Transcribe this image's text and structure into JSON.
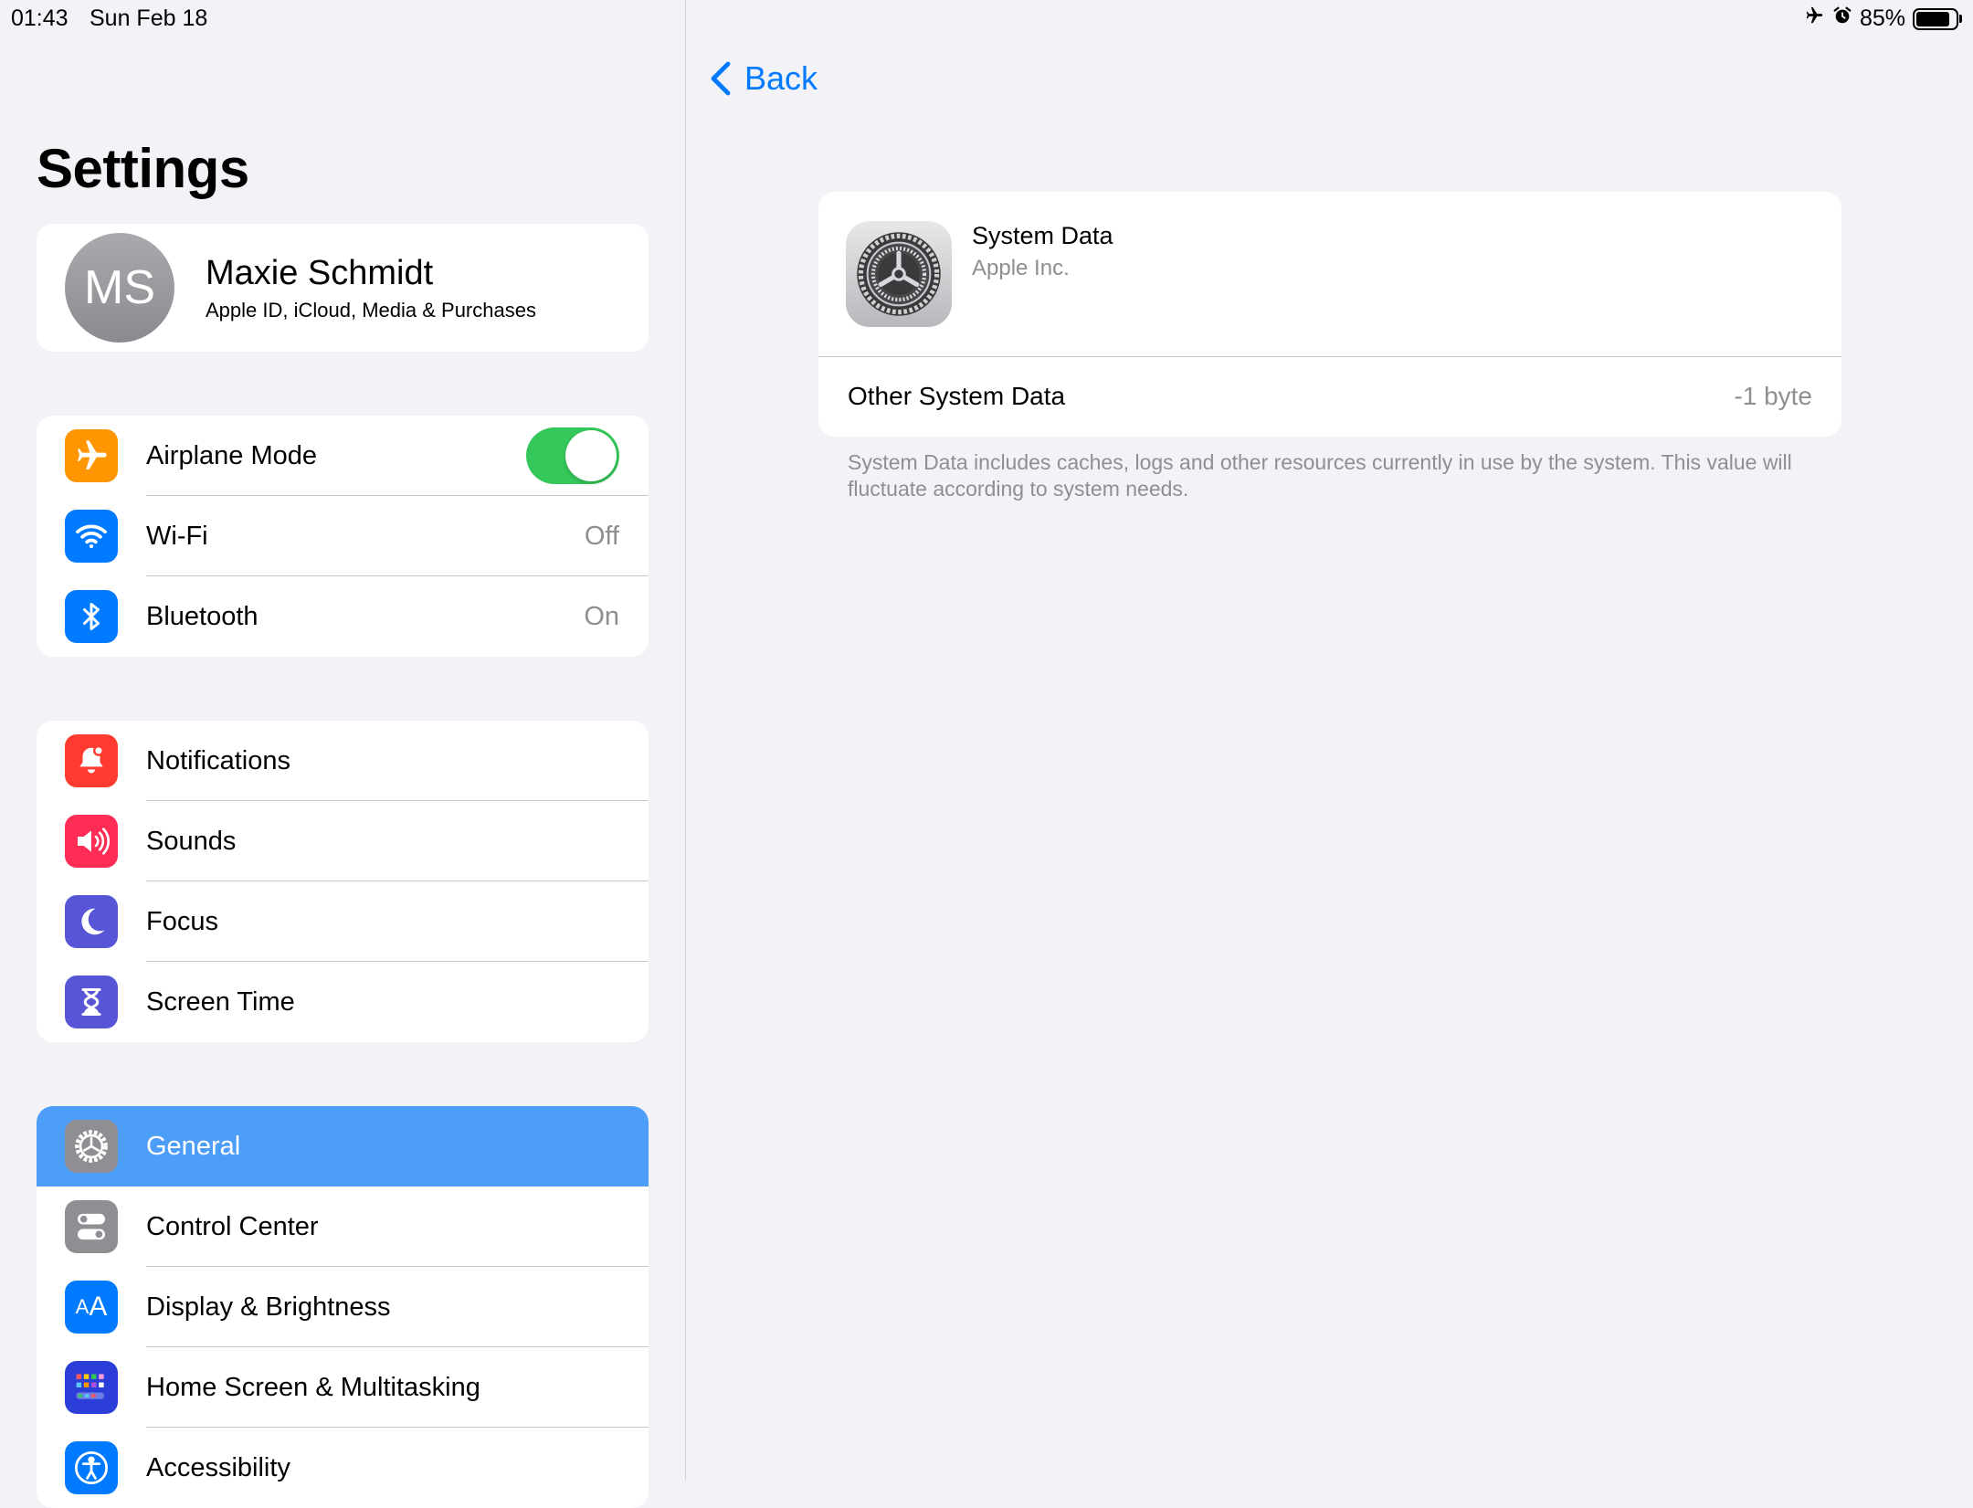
{
  "status_bar": {
    "time": "01:43",
    "date": "Sun Feb 18",
    "battery_percent": "85%",
    "battery_level": 0.85
  },
  "sidebar": {
    "title": "Settings",
    "profile": {
      "initials": "MS",
      "name": "Maxie Schmidt",
      "subtitle": "Apple ID, iCloud, Media & Purchases"
    },
    "group1": [
      {
        "label": "Airplane Mode",
        "icon": "airplane-icon",
        "color": "#ff9500",
        "toggle": true
      },
      {
        "label": "Wi-Fi",
        "icon": "wifi-icon",
        "color": "#007aff",
        "value": "Off"
      },
      {
        "label": "Bluetooth",
        "icon": "bluetooth-icon",
        "color": "#007aff",
        "value": "On"
      }
    ],
    "group2": [
      {
        "label": "Notifications",
        "icon": "bell-icon",
        "color": "#ff3b30"
      },
      {
        "label": "Sounds",
        "icon": "speaker-icon",
        "color": "#ff2d55"
      },
      {
        "label": "Focus",
        "icon": "moon-icon",
        "color": "#5856d6"
      },
      {
        "label": "Screen Time",
        "icon": "hourglass-icon",
        "color": "#5856d6"
      }
    ],
    "group3": [
      {
        "label": "General",
        "icon": "gear-icon",
        "color": "#8e8e93",
        "selected": true
      },
      {
        "label": "Control Center",
        "icon": "switches-icon",
        "color": "#8e8e93"
      },
      {
        "label": "Display & Brightness",
        "icon": "text-size-icon",
        "color": "#007aff"
      },
      {
        "label": "Home Screen & Multitasking",
        "icon": "app-grid-icon",
        "color": "#2c3ed8"
      },
      {
        "label": "Accessibility",
        "icon": "accessibility-icon",
        "color": "#007aff"
      }
    ]
  },
  "detail": {
    "back_label": "Back",
    "app_name": "System Data",
    "app_vendor": "Apple Inc.",
    "row_label": "Other System Data",
    "row_value": "-1 byte",
    "footnote": "System Data includes caches, logs and other resources currently in use by the system. This value will fluctuate according to system needs."
  },
  "colors": {
    "accent": "#007aff",
    "selection": "#4d9ef8",
    "toggle_on": "#34c759",
    "background": "#f2f2f7"
  }
}
